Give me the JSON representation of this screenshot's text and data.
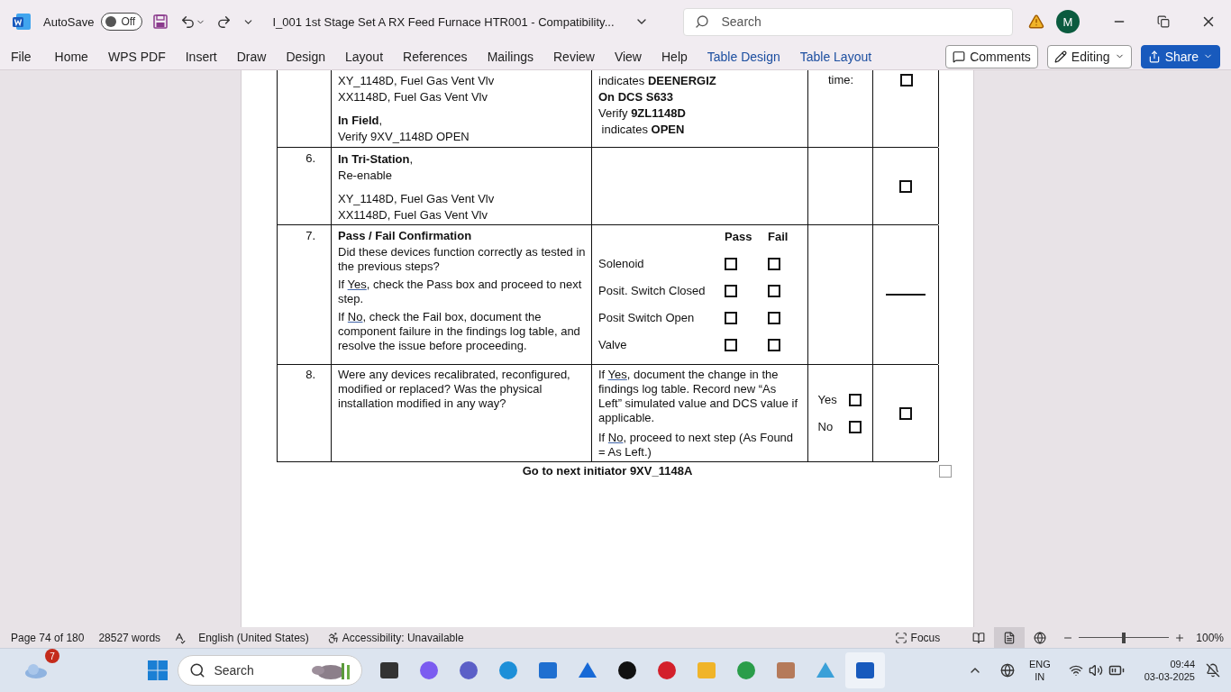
{
  "title_bar": {
    "autosave": {
      "label": "AutoSave",
      "state": "Off",
      "on": false
    },
    "document_title": "I_001 1st Stage Set A RX Feed Furnace HTR001  -  Compatibility...",
    "search": {
      "placeholder": "Search"
    },
    "avatar": "M"
  },
  "ribbon": {
    "tabs": [
      {
        "label": "File",
        "kind": "standard"
      },
      {
        "label": "Home",
        "kind": "standard"
      },
      {
        "label": "WPS PDF",
        "kind": "standard"
      },
      {
        "label": "Insert",
        "kind": "standard"
      },
      {
        "label": "Draw",
        "kind": "standard"
      },
      {
        "label": "Design",
        "kind": "standard"
      },
      {
        "label": "Layout",
        "kind": "standard"
      },
      {
        "label": "References",
        "kind": "standard"
      },
      {
        "label": "Mailings",
        "kind": "standard"
      },
      {
        "label": "Review",
        "kind": "standard"
      },
      {
        "label": "View",
        "kind": "standard"
      },
      {
        "label": "Help",
        "kind": "standard"
      },
      {
        "label": "Table Design",
        "kind": "contextual"
      },
      {
        "label": "Table Layout",
        "kind": "contextual"
      }
    ],
    "comments": "Comments",
    "editing": "Editing",
    "share": "Share"
  },
  "table": {
    "rows": [
      {
        "col1": [
          {
            "kind": "lines",
            "lines": [
              "XY_1148D, Fuel Gas Vent Vlv",
              "XX1148D, Fuel Gas Vent Vlv"
            ]
          },
          {
            "kind": "lines",
            "lines": [
              "**In Field**,",
              "Verify 9XV_1148D OPEN"
            ]
          }
        ],
        "col2": [
          {
            "kind": "lines",
            "lines": [
              "indicates **DEENERGIZ**",
              "**On DCS S633**",
              "Verify **9ZL1148D**",
              " indicates **OPEN**"
            ]
          }
        ],
        "col3": {
          "kind": "label",
          "text": "time:"
        },
        "col4": {
          "kind": "checkbox",
          "checked": false
        }
      },
      {
        "number": "6.",
        "col1": [
          {
            "kind": "lines",
            "lines": [
              "**In Tri-Station**,",
              "Re-enable"
            ]
          },
          {
            "kind": "lines",
            "lines": [
              "XY_1148D, Fuel Gas Vent Vlv",
              "XX1148D, Fuel Gas Vent Vlv"
            ]
          }
        ],
        "col2": [],
        "col4": {
          "kind": "checkbox",
          "checked": false
        }
      },
      {
        "number": "7.",
        "col1": [
          {
            "kind": "heading",
            "text": "Pass / Fail Confirmation"
          },
          {
            "kind": "sentence",
            "before": "Did these devices function correctly as tested in the previous steps?"
          },
          {
            "kind": "sentence",
            "before": "If ",
            "underlined": "Yes",
            "after": ", check the Pass box and proceed to next step."
          },
          {
            "kind": "sentence",
            "before": "If ",
            "underlined": "No",
            "after": ", check the Fail box, document the component failure in the findings log table, and resolve the issue before proceeding."
          }
        ],
        "col2": [
          {
            "kind": "pass_fail",
            "headers": [
              "Pass",
              "Fail"
            ],
            "items": [
              {
                "label": "Solenoid",
                "pass": false,
                "fail": false
              },
              {
                "label": "Posit. Switch Closed",
                "pass": false,
                "fail": false
              },
              {
                "label": "Posit Switch Open",
                "pass": false,
                "fail": false
              },
              {
                "label": "Valve",
                "pass": false,
                "fail": false
              }
            ]
          }
        ],
        "col4": {
          "kind": "line"
        }
      },
      {
        "number": "8.",
        "col1": [
          {
            "kind": "sentence",
            "before": "Were any devices recalibrated, reconfigured, modified or replaced? Was the physical installation modified in any way?"
          }
        ],
        "col2": [
          {
            "kind": "sentence",
            "before": "If ",
            "underlined": "Yes",
            "after": ", document the change in the findings log table. Record new “As Left” simulated value and DCS value if applicable."
          },
          {
            "kind": "sentence",
            "before": "If ",
            "underlined": "No",
            "after": ", proceed to next step (As Found = As Left.)"
          }
        ],
        "col3": {
          "kind": "options",
          "options": [
            {
              "label": "Yes",
              "checked": false
            },
            {
              "label": "No",
              "checked": false
            }
          ]
        },
        "col4": {
          "kind": "checkbox",
          "checked": false
        }
      }
    ]
  },
  "after_table": "Go to next initiator 9XV_1148A",
  "status_bar": {
    "page": "Page 74 of 180",
    "words": "28527 words",
    "language": "English (United States)",
    "accessibility": "Accessibility: Unavailable",
    "focus": "Focus",
    "views": [
      {
        "kind": "read",
        "selected": false
      },
      {
        "kind": "print",
        "selected": true
      },
      {
        "kind": "web",
        "selected": false
      }
    ],
    "zoom": {
      "level": 0.5,
      "reading": "100%"
    }
  },
  "taskbar": {
    "weather_badge": "7",
    "search": {
      "placeholder": "Search"
    },
    "language": [
      "ENG",
      "IN"
    ],
    "time": "09:44",
    "date": "03-03-2025"
  }
}
